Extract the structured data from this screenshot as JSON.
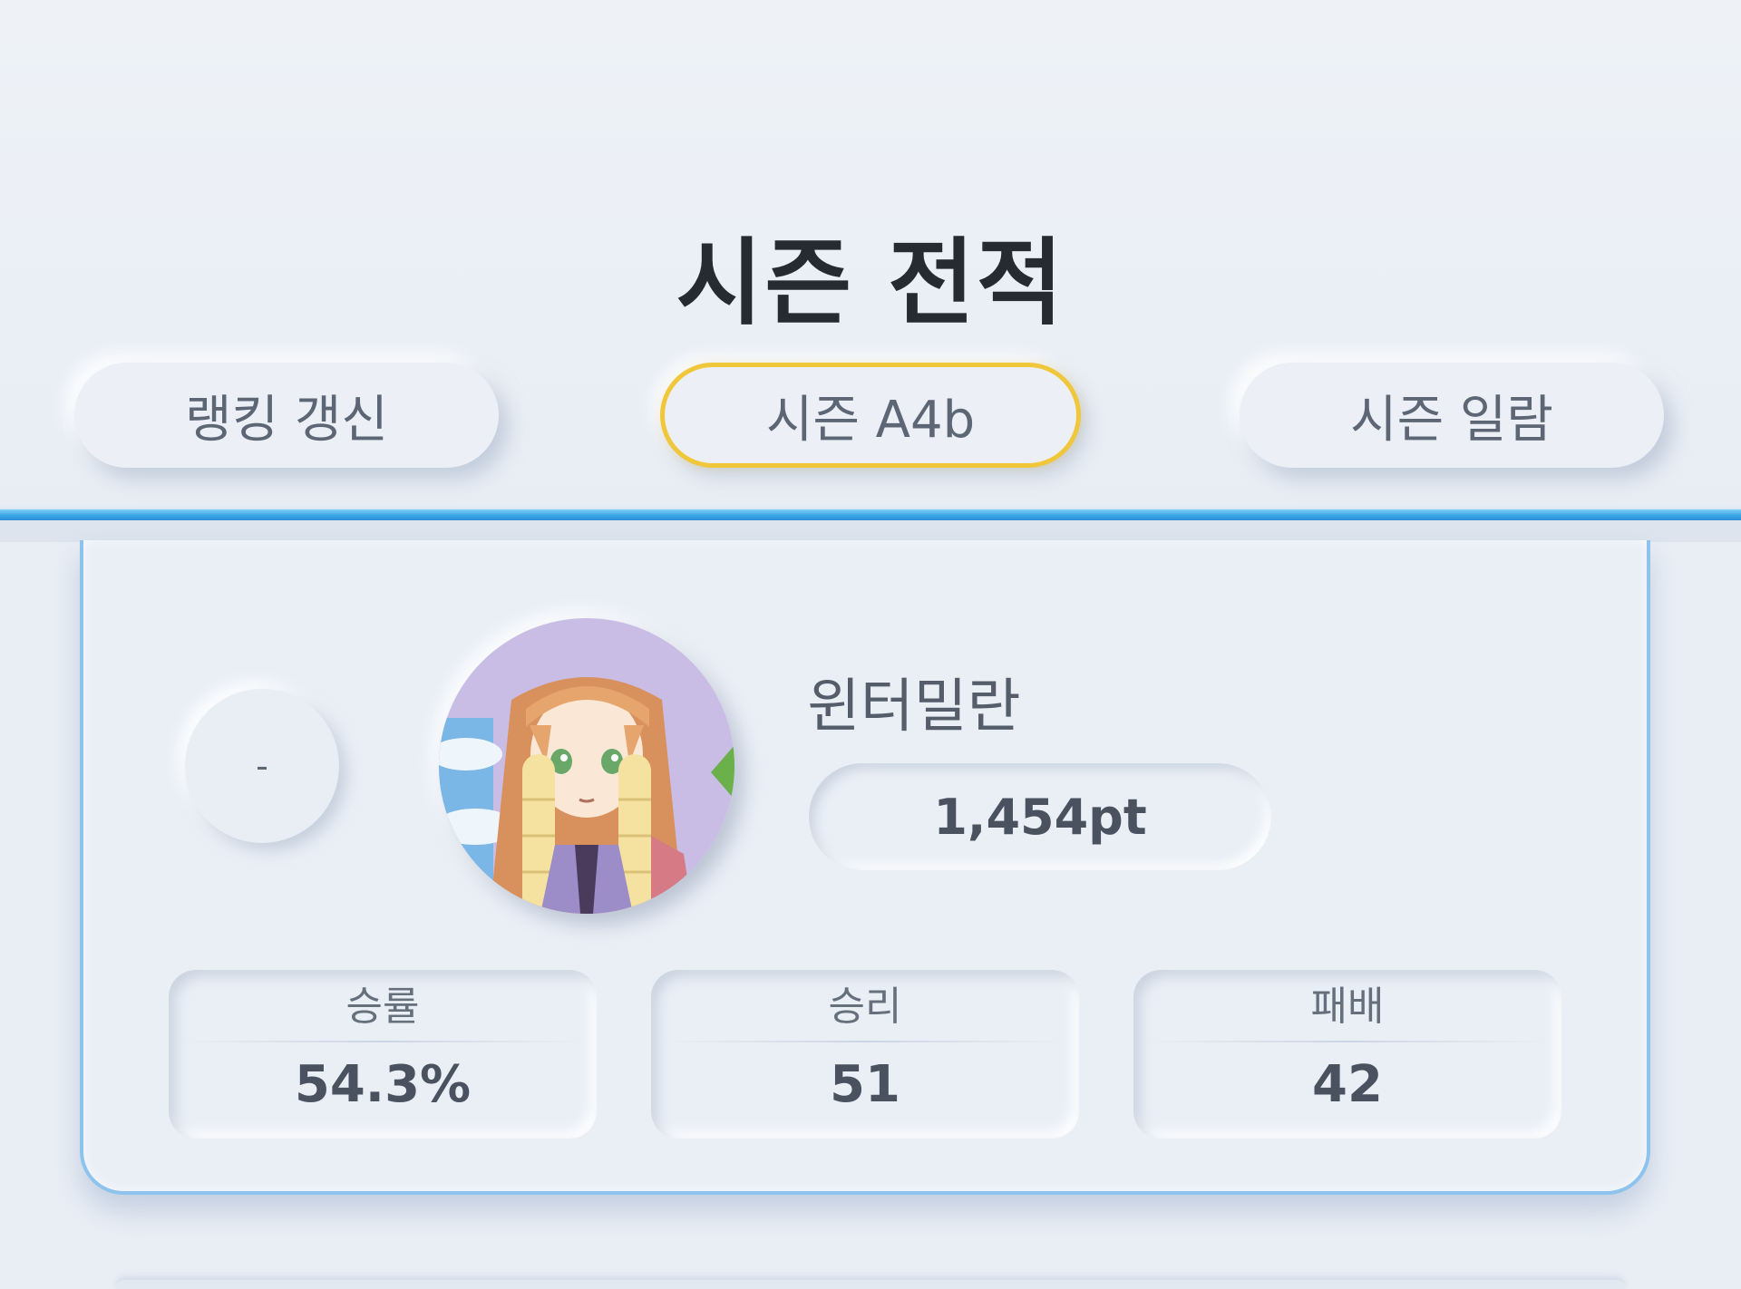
{
  "header": {
    "title": "시즌 전적",
    "buttons": {
      "refresh_label": "랭킹 갱신",
      "season_label": "시즌 A4b",
      "season_list_label": "시즌 일람"
    }
  },
  "record": {
    "rank": "-",
    "player_name": "윈터밀란",
    "points": "1,454pt",
    "stats": {
      "winrate": {
        "label": "승률",
        "value": "54.3%"
      },
      "wins": {
        "label": "승리",
        "value": "51"
      },
      "losses": {
        "label": "패배",
        "value": "42"
      }
    }
  },
  "colors": {
    "accent_gold": "#f0c63a",
    "divider_blue": "#3aa6e6",
    "card_border": "#8ec3ee",
    "background": "#e9eef5"
  }
}
